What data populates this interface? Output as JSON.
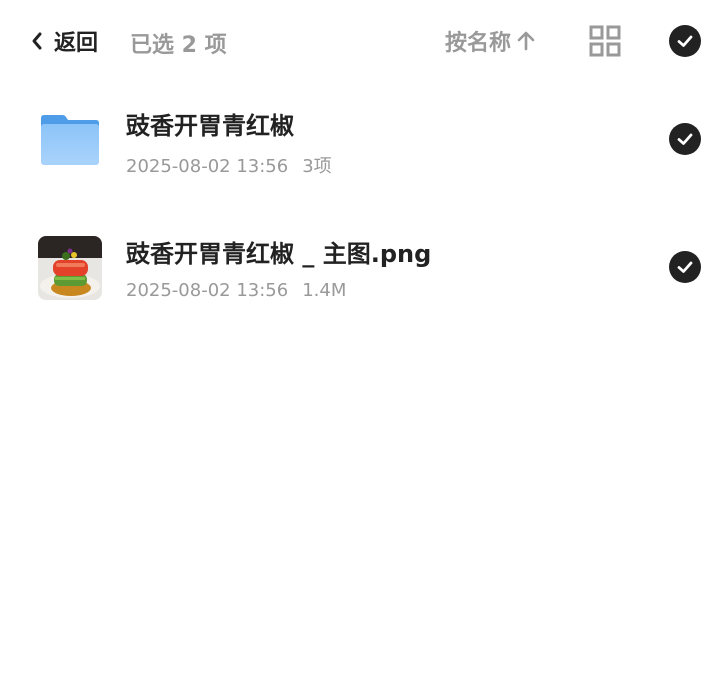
{
  "header": {
    "back_label": "返回",
    "selected_text": "已选 2 项",
    "sort_label": "按名称",
    "sort_direction_icon": "arrow-up-icon",
    "grid_icon": "grid-view-icon",
    "select_all_icon": "check-circle-icon"
  },
  "files": [
    {
      "name": "豉香开胃青红椒",
      "date": "2025-08-02 13:56",
      "info": "3项",
      "type": "folder",
      "selected": true
    },
    {
      "name": "豉香开胃青红椒 _ 主图.png",
      "date": "2025-08-02 13:56",
      "info": "1.4M",
      "type": "image",
      "selected": true
    }
  ],
  "colors": {
    "text_primary": "#222222",
    "text_secondary": "#999999",
    "folder_blue": "#6fb2f5",
    "check_bg": "#222222"
  }
}
